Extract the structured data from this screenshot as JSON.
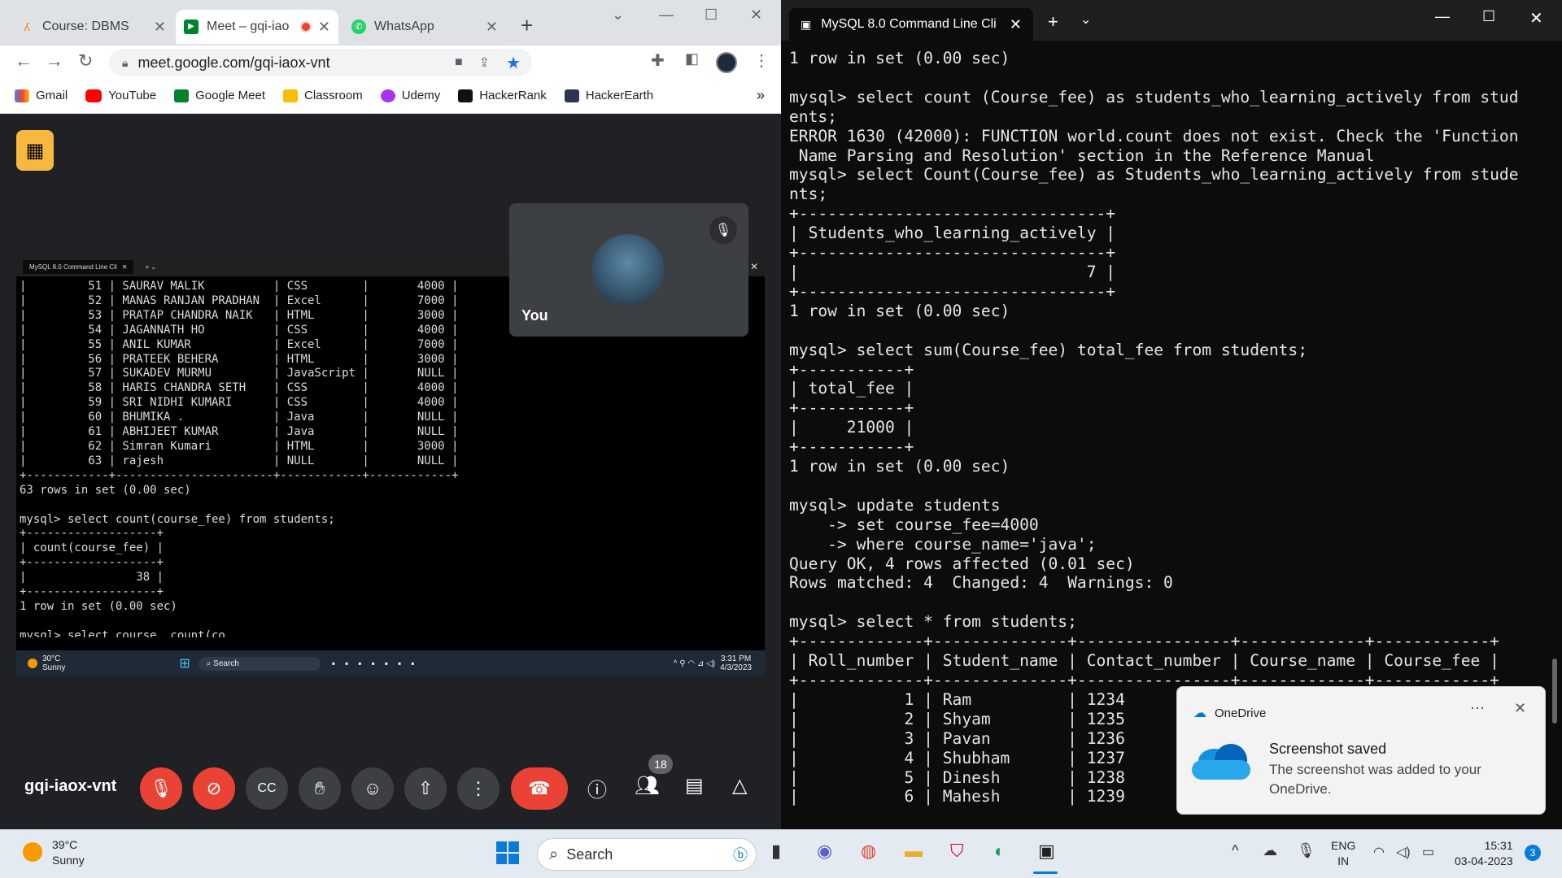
{
  "chrome": {
    "tabs": [
      {
        "label": "Course: DBMS",
        "icon": "moodle-icon"
      },
      {
        "label": "Meet – gqi-iao",
        "icon": "google-meet-icon",
        "recording": true
      },
      {
        "label": "WhatsApp",
        "icon": "whatsapp-icon"
      }
    ],
    "url": "meet.google.com/gqi-iaox-vnt",
    "bookmarks": [
      "Gmail",
      "YouTube",
      "Google Meet",
      "Classroom",
      "Udemy",
      "HackerRank",
      "HackerEarth"
    ],
    "more_bookmarks": "»"
  },
  "meet": {
    "code": "gqi-iaox-vnt",
    "self_name": "You",
    "participants_count": "18",
    "shared_screen": {
      "tab_title": "MySQL 8.0 Command Line Cli",
      "lines": [
        "|         51 | SAURAV MALIK          | CSS        |       4000 |",
        "|         52 | MANAS RANJAN PRADHAN  | Excel      |       7000 |",
        "|         53 | PRATAP CHANDRA NAIK   | HTML       |       3000 |",
        "|         54 | JAGANNATH HO          | CSS        |       4000 |",
        "|         55 | ANIL KUMAR            | Excel      |       7000 |",
        "|         56 | PRATEEK BEHERA        | HTML       |       3000 |",
        "|         57 | SUKADEV MURMU         | JavaScript |       NULL |",
        "|         58 | HARIS CHANDRA SETH    | CSS        |       4000 |",
        "|         59 | SRI NIDHI KUMARI      | CSS        |       4000 |",
        "|         60 | BHUMIKA .             | Java       |       NULL |",
        "|         61 | ABHIJEET KUMAR        | Java       |       NULL |",
        "|         62 | Simran Kumari         | HTML       |       3000 |",
        "|         63 | rajesh                | NULL       |       NULL |",
        "+------------+-----------------------+------------+------------+",
        "63 rows in set (0.00 sec)",
        "",
        "mysql> select count(course_fee) from students;",
        "+-------------------+",
        "| count(course_fee) |",
        "+-------------------+",
        "|                38 |",
        "+-------------------+",
        "1 row in set (0.00 sec)",
        "",
        "mysql> select course, count(co"
      ],
      "weather_temp": "30°C",
      "weather_desc": "Sunny",
      "search": "Search",
      "time": "3:31 PM",
      "date": "4/3/2023"
    }
  },
  "terminal": {
    "tab_title": "MySQL 8.0 Command Line Cli",
    "lines": [
      "1 row in set (0.00 sec)",
      "",
      "mysql> select count (Course_fee) as students_who_learning_actively from stud",
      "ents;",
      "ERROR 1630 (42000): FUNCTION world.count does not exist. Check the 'Function",
      " Name Parsing and Resolution' section in the Reference Manual",
      "mysql> select Count(Course_fee) as Students_who_learning_actively from stude",
      "nts;",
      "+--------------------------------+",
      "| Students_who_learning_actively |",
      "+--------------------------------+",
      "|                              7 |",
      "+--------------------------------+",
      "1 row in set (0.00 sec)",
      "",
      "mysql> select sum(Course_fee) total_fee from students;",
      "+-----------+",
      "| total_fee |",
      "+-----------+",
      "|     21000 |",
      "+-----------+",
      "1 row in set (0.00 sec)",
      "",
      "mysql> update students",
      "    -> set course_fee=4000",
      "    -> where course_name='java';",
      "Query OK, 4 rows affected (0.01 sec)",
      "Rows matched: 4  Changed: 4  Warnings: 0",
      "",
      "mysql> select * from students;",
      "+-------------+--------------+----------------+-------------+------------+",
      "| Roll_number | Student_name | Contact_number | Course_name | Course_fee |",
      "+-------------+--------------+----------------+-------------+------------+",
      "|           1 | Ram          | 1234",
      "|           2 | Shyam        | 1235",
      "|           3 | Pavan        | 1236",
      "|           4 | Shubham      | 1237",
      "|           5 | Dinesh       | 1238",
      "|           6 | Mahesh       | 1239"
    ]
  },
  "toast": {
    "app": "OneDrive",
    "title": "Screenshot saved",
    "message": "The screenshot was added to your OneDrive."
  },
  "taskbar": {
    "weather_temp": "39°C",
    "weather_desc": "Sunny",
    "search": "Search",
    "lang1": "ENG",
    "lang2": "IN",
    "time": "15:31",
    "date": "03-04-2023",
    "notifications": "3"
  }
}
